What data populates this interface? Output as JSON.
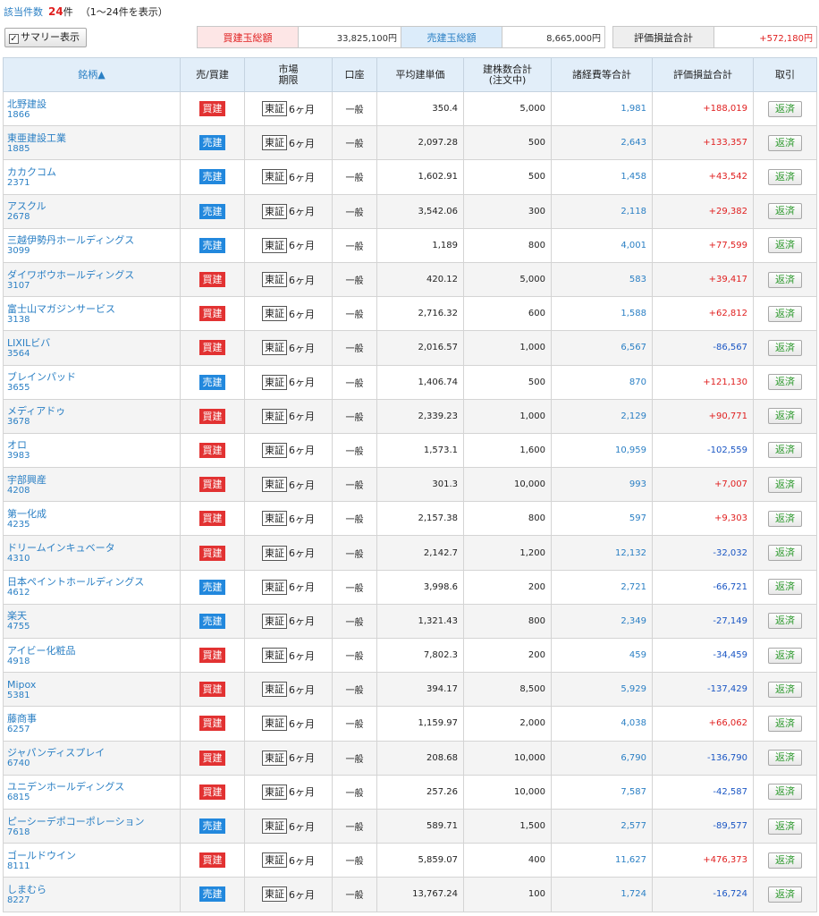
{
  "header": {
    "count_label": "該当件数",
    "count_value": "24",
    "count_suffix": "件",
    "range_text": "（1～24件を表示）",
    "summary_checkbox_mark": "✓",
    "summary_label": "サマリー表示"
  },
  "totals": {
    "buy_label": "買建玉総額",
    "buy_value": "33,825,100円",
    "sell_label": "売建玉総額",
    "sell_value": "8,665,000円",
    "pl_label": "評価損益合計",
    "pl_value": "+572,180円"
  },
  "columns": {
    "name": "銘柄▲",
    "side": "売/買建",
    "market_line1": "市場",
    "market_line2": "期限",
    "account": "口座",
    "avg_price": "平均建単価",
    "qty_line1": "建株数合計",
    "qty_line2": "(注文中)",
    "fees": "諸経費等合計",
    "pl": "評価損益合計",
    "action": "取引"
  },
  "colors": {
    "buy_badge": "#e23232",
    "sell_badge": "#2288dd",
    "positive": "#e02020",
    "negative": "#1a56c4",
    "link": "#2a7fc4",
    "header_bg": "#e2eef9"
  },
  "rows": [
    {
      "name": "北野建設",
      "code": "1866",
      "side": "買建",
      "side_type": "buy",
      "market": "東証",
      "term": "6ヶ月",
      "account": "一般",
      "avg_price": "350.4",
      "qty": "5,000",
      "fees": "1,981",
      "pl": "+188,019",
      "action": "返済"
    },
    {
      "name": "東亜建設工業",
      "code": "1885",
      "side": "売建",
      "side_type": "sell",
      "market": "東証",
      "term": "6ヶ月",
      "account": "一般",
      "avg_price": "2,097.28",
      "qty": "500",
      "fees": "2,643",
      "pl": "+133,357",
      "action": "返済"
    },
    {
      "name": "カカクコム",
      "code": "2371",
      "side": "売建",
      "side_type": "sell",
      "market": "東証",
      "term": "6ヶ月",
      "account": "一般",
      "avg_price": "1,602.91",
      "qty": "500",
      "fees": "1,458",
      "pl": "+43,542",
      "action": "返済"
    },
    {
      "name": "アスクル",
      "code": "2678",
      "side": "売建",
      "side_type": "sell",
      "market": "東証",
      "term": "6ヶ月",
      "account": "一般",
      "avg_price": "3,542.06",
      "qty": "300",
      "fees": "2,118",
      "pl": "+29,382",
      "action": "返済"
    },
    {
      "name": "三越伊勢丹ホールディングス",
      "code": "3099",
      "side": "売建",
      "side_type": "sell",
      "market": "東証",
      "term": "6ヶ月",
      "account": "一般",
      "avg_price": "1,189",
      "qty": "800",
      "fees": "4,001",
      "pl": "+77,599",
      "action": "返済"
    },
    {
      "name": "ダイワボウホールディングス",
      "code": "3107",
      "side": "買建",
      "side_type": "buy",
      "market": "東証",
      "term": "6ヶ月",
      "account": "一般",
      "avg_price": "420.12",
      "qty": "5,000",
      "fees": "583",
      "pl": "+39,417",
      "action": "返済"
    },
    {
      "name": "富士山マガジンサービス",
      "code": "3138",
      "side": "買建",
      "side_type": "buy",
      "market": "東証",
      "term": "6ヶ月",
      "account": "一般",
      "avg_price": "2,716.32",
      "qty": "600",
      "fees": "1,588",
      "pl": "+62,812",
      "action": "返済"
    },
    {
      "name": "LIXILビバ",
      "code": "3564",
      "side": "買建",
      "side_type": "buy",
      "market": "東証",
      "term": "6ヶ月",
      "account": "一般",
      "avg_price": "2,016.57",
      "qty": "1,000",
      "fees": "6,567",
      "pl": "-86,567",
      "action": "返済"
    },
    {
      "name": "ブレインパッド",
      "code": "3655",
      "side": "売建",
      "side_type": "sell",
      "market": "東証",
      "term": "6ヶ月",
      "account": "一般",
      "avg_price": "1,406.74",
      "qty": "500",
      "fees": "870",
      "pl": "+121,130",
      "action": "返済"
    },
    {
      "name": "メディアドゥ",
      "code": "3678",
      "side": "買建",
      "side_type": "buy",
      "market": "東証",
      "term": "6ヶ月",
      "account": "一般",
      "avg_price": "2,339.23",
      "qty": "1,000",
      "fees": "2,129",
      "pl": "+90,771",
      "action": "返済"
    },
    {
      "name": "オロ",
      "code": "3983",
      "side": "買建",
      "side_type": "buy",
      "market": "東証",
      "term": "6ヶ月",
      "account": "一般",
      "avg_price": "1,573.1",
      "qty": "1,600",
      "fees": "10,959",
      "pl": "-102,559",
      "action": "返済"
    },
    {
      "name": "宇部興産",
      "code": "4208",
      "side": "買建",
      "side_type": "buy",
      "market": "東証",
      "term": "6ヶ月",
      "account": "一般",
      "avg_price": "301.3",
      "qty": "10,000",
      "fees": "993",
      "pl": "+7,007",
      "action": "返済"
    },
    {
      "name": "第一化成",
      "code": "4235",
      "side": "買建",
      "side_type": "buy",
      "market": "東証",
      "term": "6ヶ月",
      "account": "一般",
      "avg_price": "2,157.38",
      "qty": "800",
      "fees": "597",
      "pl": "+9,303",
      "action": "返済"
    },
    {
      "name": "ドリームインキュベータ",
      "code": "4310",
      "side": "買建",
      "side_type": "buy",
      "market": "東証",
      "term": "6ヶ月",
      "account": "一般",
      "avg_price": "2,142.7",
      "qty": "1,200",
      "fees": "12,132",
      "pl": "-32,032",
      "action": "返済"
    },
    {
      "name": "日本ペイントホールディングス",
      "code": "4612",
      "side": "売建",
      "side_type": "sell",
      "market": "東証",
      "term": "6ヶ月",
      "account": "一般",
      "avg_price": "3,998.6",
      "qty": "200",
      "fees": "2,721",
      "pl": "-66,721",
      "action": "返済"
    },
    {
      "name": "楽天",
      "code": "4755",
      "side": "売建",
      "side_type": "sell",
      "market": "東証",
      "term": "6ヶ月",
      "account": "一般",
      "avg_price": "1,321.43",
      "qty": "800",
      "fees": "2,349",
      "pl": "-27,149",
      "action": "返済"
    },
    {
      "name": "アイビー化粧品",
      "code": "4918",
      "side": "買建",
      "side_type": "buy",
      "market": "東証",
      "term": "6ヶ月",
      "account": "一般",
      "avg_price": "7,802.3",
      "qty": "200",
      "fees": "459",
      "pl": "-34,459",
      "action": "返済"
    },
    {
      "name": "Mipox",
      "code": "5381",
      "side": "買建",
      "side_type": "buy",
      "market": "東証",
      "term": "6ヶ月",
      "account": "一般",
      "avg_price": "394.17",
      "qty": "8,500",
      "fees": "5,929",
      "pl": "-137,429",
      "action": "返済"
    },
    {
      "name": "藤商事",
      "code": "6257",
      "side": "買建",
      "side_type": "buy",
      "market": "東証",
      "term": "6ヶ月",
      "account": "一般",
      "avg_price": "1,159.97",
      "qty": "2,000",
      "fees": "4,038",
      "pl": "+66,062",
      "action": "返済"
    },
    {
      "name": "ジャパンディスプレイ",
      "code": "6740",
      "side": "買建",
      "side_type": "buy",
      "market": "東証",
      "term": "6ヶ月",
      "account": "一般",
      "avg_price": "208.68",
      "qty": "10,000",
      "fees": "6,790",
      "pl": "-136,790",
      "action": "返済"
    },
    {
      "name": "ユニデンホールディングス",
      "code": "6815",
      "side": "買建",
      "side_type": "buy",
      "market": "東証",
      "term": "6ヶ月",
      "account": "一般",
      "avg_price": "257.26",
      "qty": "10,000",
      "fees": "7,587",
      "pl": "-42,587",
      "action": "返済"
    },
    {
      "name": "ピーシーデポコーポレーション",
      "code": "7618",
      "side": "売建",
      "side_type": "sell",
      "market": "東証",
      "term": "6ヶ月",
      "account": "一般",
      "avg_price": "589.71",
      "qty": "1,500",
      "fees": "2,577",
      "pl": "-89,577",
      "action": "返済"
    },
    {
      "name": "ゴールドウイン",
      "code": "8111",
      "side": "買建",
      "side_type": "buy",
      "market": "東証",
      "term": "6ヶ月",
      "account": "一般",
      "avg_price": "5,859.07",
      "qty": "400",
      "fees": "11,627",
      "pl": "+476,373",
      "action": "返済"
    },
    {
      "name": "しまむら",
      "code": "8227",
      "side": "売建",
      "side_type": "sell",
      "market": "東証",
      "term": "6ヶ月",
      "account": "一般",
      "avg_price": "13,767.24",
      "qty": "100",
      "fees": "1,724",
      "pl": "-16,724",
      "action": "返済"
    }
  ]
}
